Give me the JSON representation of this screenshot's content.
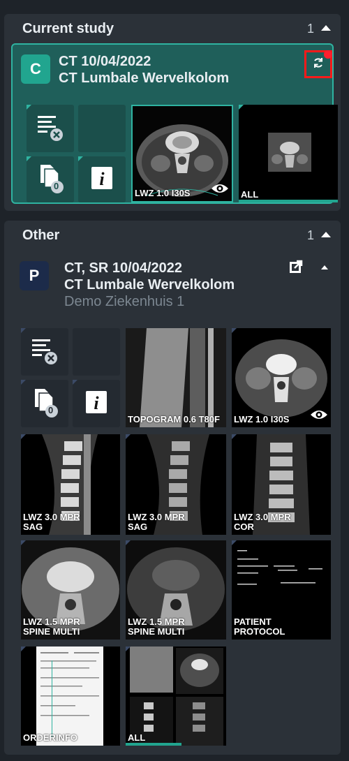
{
  "current": {
    "header": "Current study",
    "count": "1",
    "study": {
      "avatar": "C",
      "modality_date": "CT 10/04/2022",
      "description": "CT Lumbale Wervelkolom"
    },
    "doc_count": "0",
    "thumbs": [
      {
        "label": "LWZ 1.0 I30S",
        "eye": true
      },
      {
        "label": "ALL",
        "eye": false
      }
    ]
  },
  "other": {
    "header": "Other",
    "count": "1",
    "study": {
      "avatar": "P",
      "modality_date": "CT, SR 10/04/2022",
      "description": "CT Lumbale Wervelkolom",
      "hospital": "Demo Ziekenhuis 1"
    },
    "doc_count": "0",
    "thumbs": [
      {
        "label": "TOPOGRAM 0.6 T80F"
      },
      {
        "label": "LWZ 1.0 I30S"
      },
      {
        "label": "LWZ 3.0 MPR SAG"
      },
      {
        "label": "LWZ 3.0 MPR SAG"
      },
      {
        "label": "LWZ 3.0 MPR COR"
      },
      {
        "label": "LWZ 1.5 MPR SPINE MULTI"
      },
      {
        "label": "LWZ 1.5 MPR SPINE MULTI"
      },
      {
        "label": "PATIENT PROTOCOL"
      },
      {
        "label": "ORDERINFO"
      },
      {
        "label": "ALL"
      }
    ]
  },
  "colors": {
    "accent_teal": "#2fb3a1",
    "selected_bg": "#1f5f5a",
    "alert_red": "#ff1a1a",
    "patient_avatar": "#1c2b4a"
  },
  "icons": [
    "chevron-up-icon",
    "sync-icon",
    "report-remove-icon",
    "documents-icon",
    "info-icon",
    "eye-icon",
    "external-link-icon"
  ]
}
